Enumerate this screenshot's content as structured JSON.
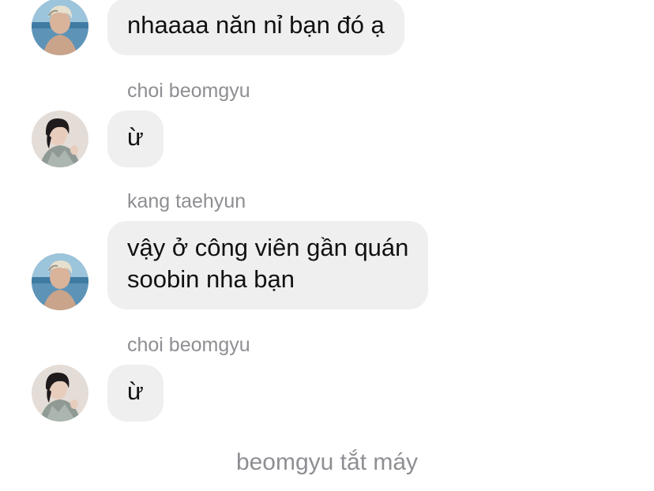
{
  "thread": {
    "messages": [
      {
        "sender": "",
        "lines": [
          "nhaaaa năn nỉ bạn đó ạ"
        ]
      },
      {
        "sender": "choi beomgyu",
        "lines": [
          "ừ"
        ]
      },
      {
        "sender": "kang taehyun",
        "lines": [
          "vậy ở công viên gần quán",
          "soobin nha bạn"
        ]
      },
      {
        "sender": "choi beomgyu",
        "lines": [
          "ừ"
        ]
      }
    ],
    "status_text": "beomgyu tắt máy"
  },
  "avatars": {
    "taehyun": {
      "icon": "avatar-photo-blond-beach"
    },
    "beomgyu": {
      "icon": "avatar-photo-dark-hair"
    }
  },
  "colors": {
    "bubble_bg": "#efefef",
    "meta_text": "#8e8e93",
    "message_text": "#111111"
  }
}
